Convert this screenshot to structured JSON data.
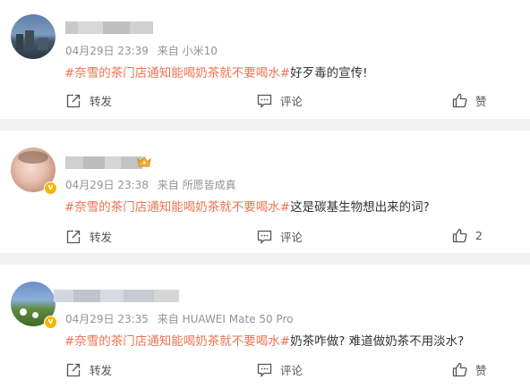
{
  "posts": [
    {
      "time": "04月29日 23:39",
      "source": "来自 小米10",
      "hashtag": "#奈雪的茶门店通知能喝奶茶就不要喝水#",
      "text": "好歹毒的宣传!",
      "actions": {
        "repost": "转发",
        "comment": "评论",
        "like": "赞"
      }
    },
    {
      "time": "04月29日 23:38",
      "source": "来自 所愿皆成真",
      "hashtag": "#奈雪的茶门店通知能喝奶茶就不要喝水#",
      "text": "这是碳基生物想出来的词?",
      "actions": {
        "repost": "转发",
        "comment": "评论",
        "like": "2"
      }
    },
    {
      "time": "04月29日 23:35",
      "source": "来自 HUAWEI Mate 50 Pro",
      "hashtag": "#奈雪的茶门店通知能喝奶茶就不要喝水#",
      "text": "奶茶咋做? 难道做奶茶不用淡水?",
      "actions": {
        "repost": "转发",
        "comment": "评论",
        "like": "赞"
      }
    }
  ],
  "icons": {
    "repost": "share-arrow-icon",
    "comment": "comment-icon",
    "like": "thumbs-up-icon",
    "verified": "verified-badge-icon",
    "crown": "crown-icon"
  },
  "colors": {
    "hashtag": "#eb7350",
    "meta": "#939393",
    "separator": "#f1f1f1",
    "verified": "#f7b500"
  }
}
